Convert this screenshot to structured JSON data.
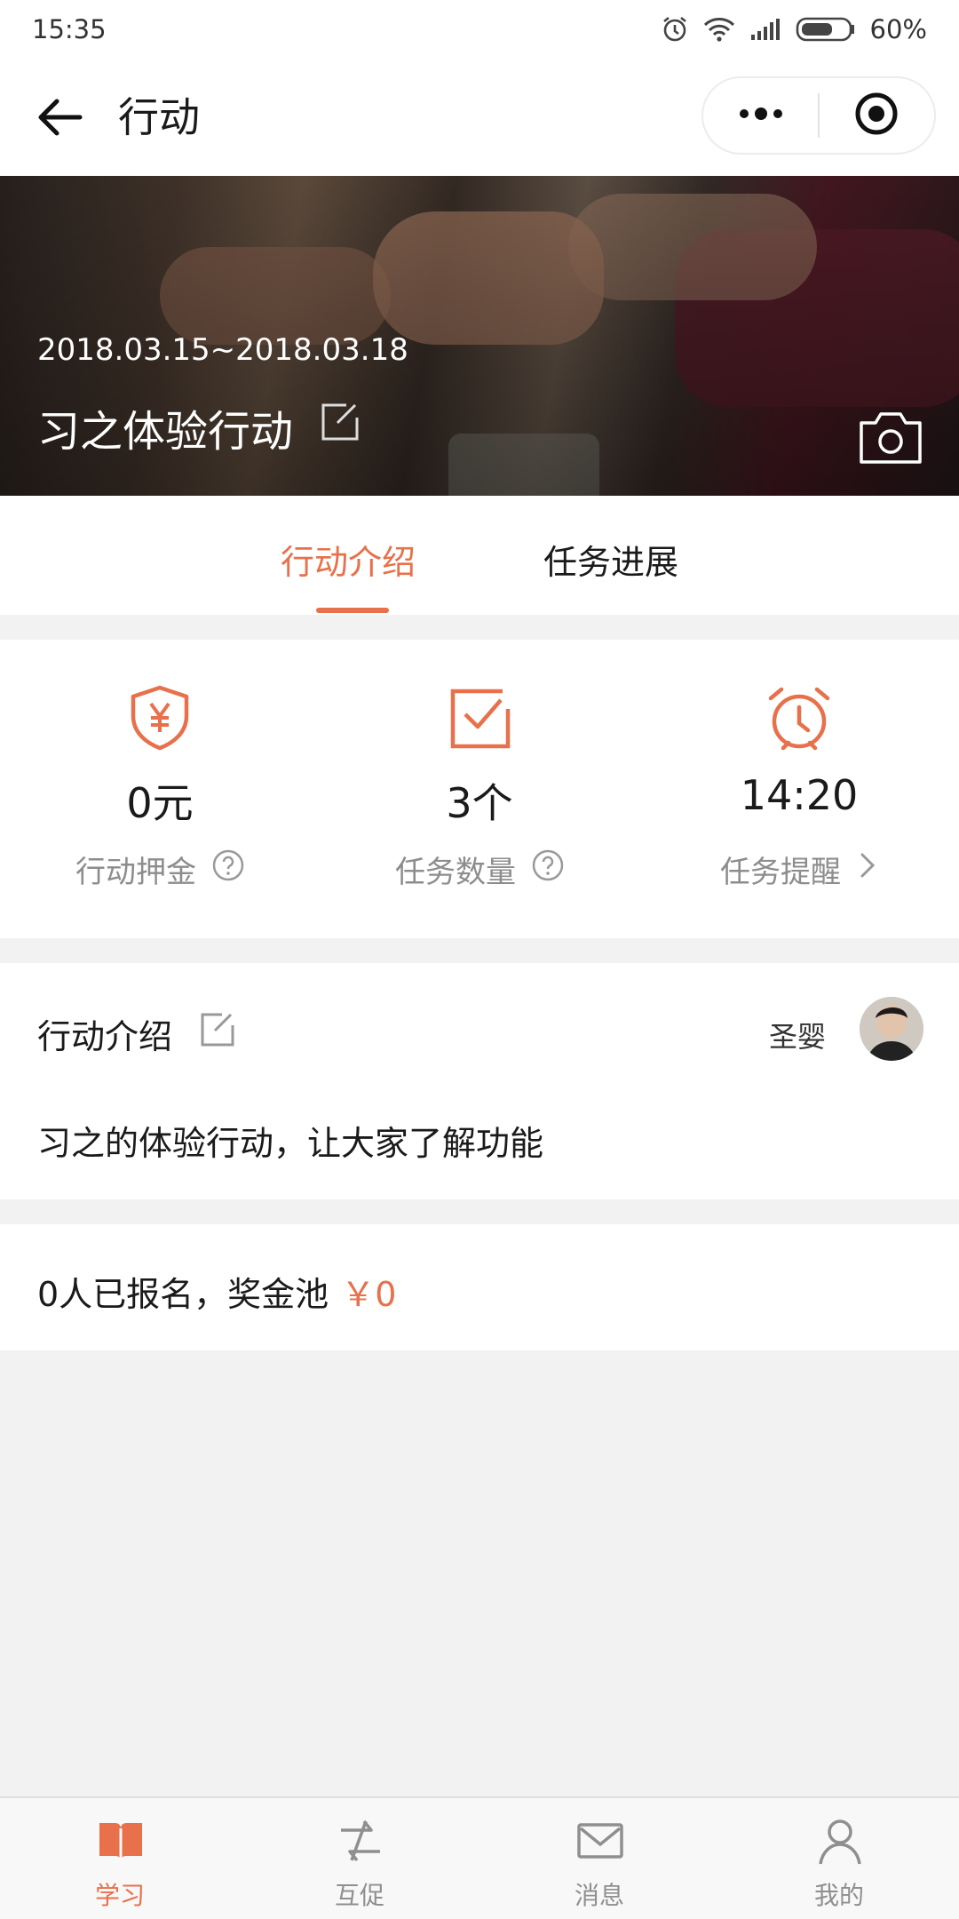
{
  "status_bar": {
    "time": "15:35",
    "battery": "60%",
    "icons": [
      "alarm-icon",
      "wifi-icon",
      "signal-icon",
      "battery-icon"
    ]
  },
  "nav": {
    "title": "行动",
    "back_icon": "arrow-left-icon",
    "more_icon": "more-dots-icon",
    "close_icon": "target-circle-icon"
  },
  "banner": {
    "date_range": "2018.03.15~2018.03.18",
    "title": "习之体验行动",
    "edit_icon": "edit-icon",
    "camera_icon": "camera-icon"
  },
  "tabs": [
    {
      "label": "行动介绍",
      "active": true
    },
    {
      "label": "任务进展",
      "active": false
    }
  ],
  "stats": [
    {
      "icon": "yuan-shield-icon",
      "value": "0元",
      "label": "行动押金",
      "suffix_icon": "help-circle-icon"
    },
    {
      "icon": "check-square-icon",
      "value": "3个",
      "label": "任务数量",
      "suffix_icon": "help-circle-icon"
    },
    {
      "icon": "alarm-clock-icon",
      "value": "14:20",
      "label": "任务提醒",
      "suffix_icon": "chevron-right-icon"
    }
  ],
  "intro": {
    "title": "行动介绍",
    "author": "圣婴",
    "text": "习之的体验行动，让大家了解功能"
  },
  "signup": {
    "text": "0人已报名，奖金池",
    "amount": "￥0"
  },
  "bottom_tabs": [
    {
      "label": "学习",
      "icon": "book-icon",
      "active": true
    },
    {
      "label": "互促",
      "icon": "interact-icon",
      "active": false
    },
    {
      "label": "消息",
      "icon": "mail-icon",
      "active": false
    },
    {
      "label": "我的",
      "icon": "user-icon",
      "active": false
    }
  ],
  "colors": {
    "accent": "#e8704b",
    "background": "#f2f2f2",
    "text": "#1a1a1a",
    "muted": "#8d8d8d"
  }
}
